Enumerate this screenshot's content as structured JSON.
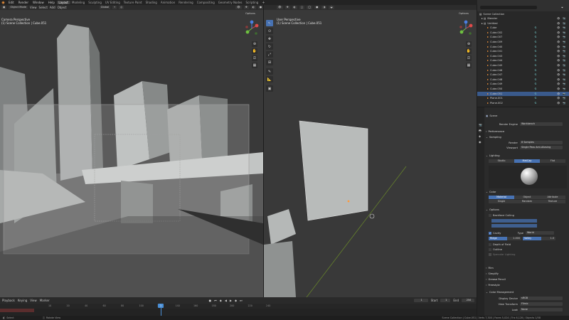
{
  "topbar": {
    "menus": [
      "Edit",
      "Render",
      "Window",
      "Help"
    ],
    "workspaces": [
      "Layout",
      "Modeling",
      "Sculpting",
      "UV Editing",
      "Texture Paint",
      "Shading",
      "Animation",
      "Rendering",
      "Compositing",
      "Geometry Nodes",
      "Scripting"
    ],
    "scene": "Scene",
    "view_layer": "ViewLayer"
  },
  "viewport_left": {
    "mode": "Object Mode",
    "menus": [
      "View",
      "Select",
      "Add",
      "Object"
    ],
    "transform": "Global",
    "label_line1": "Camera Perspective",
    "label_line2": "(1) Scene Collection | Cube.051",
    "options": "Options"
  },
  "viewport_right": {
    "label_line1": "User Perspective",
    "label_line2": "(1) Scene Collection | Cube.051",
    "options": "Options"
  },
  "outliner": {
    "root": "Scene Collection",
    "rows": [
      "Blender",
      "Untitled",
      "Cube",
      "Cube.002",
      "Cube.007",
      "Cube.009",
      "Cube.040",
      "Cube.041",
      "Cube.043",
      "Cube.044",
      "Cube.045",
      "Cube.046",
      "Cube.047",
      "Cube.048",
      "Cube.049",
      "Cube.050",
      "Cube.051",
      "Plane.001",
      "Plane.002"
    ],
    "selected_index": 16
  },
  "properties": {
    "scene": "Scene",
    "render_engine_label": "Render Engine",
    "render_engine_value": "Workbench",
    "performance": "Performance",
    "sampling": "Sampling",
    "render_label": "Render",
    "render_value": "8 Samples",
    "viewport_label": "Viewport",
    "viewport_value": "Single Pass Anti-Aliasing",
    "lighting": "Lighting",
    "lighting_modes": [
      "Studio",
      "MatCap",
      "Flat"
    ],
    "color": "Color",
    "color_modes": [
      "Material",
      "Object",
      "Attribute",
      "Single",
      "Random",
      "Texture"
    ],
    "options": "Options",
    "backface_culling": "Backface Culling",
    "cavity": "Cavity",
    "type_label": "Type",
    "type_value": "World",
    "ridge": "Ridge",
    "ridge_value": "1.000",
    "valley": "Valley",
    "depth_of_field": "Depth of Field",
    "outline": "Outline",
    "specular": "Specular Lighting",
    "film": "Film",
    "simplify": "Simplify",
    "grease_pencil": "Grease Pencil",
    "freestyle": "Freestyle",
    "color_management": "Color Management",
    "display_device_label": "Display Device",
    "display_device_value": "sRGB",
    "view_transform_label": "View Transform",
    "view_transform_value": "Filmic",
    "look_label": "Look",
    "look_value": "None"
  },
  "timeline": {
    "menus": [
      "Playback",
      "Keying",
      "View",
      "Marker"
    ],
    "frame_numbers": [
      "10",
      "20",
      "40",
      "60",
      "80",
      "100",
      "120",
      "140",
      "160",
      "180",
      "200",
      "220",
      "240"
    ],
    "current_frame": "1",
    "start_label": "Start",
    "start": "1",
    "end_label": "End",
    "end": "250"
  },
  "statusbar": {
    "left": "Select",
    "middle": "Rotate View",
    "right": "Scene Collection | Cube.051 | Verts 7,300 | Faces 5,024 | Tris 6,128 | Objects 1/58"
  },
  "colors": {
    "accent": "#4772b3",
    "selection": "#3a5a8c",
    "object_icon": "#ff9a3c",
    "timeline_frame": "#4a8fd6"
  }
}
